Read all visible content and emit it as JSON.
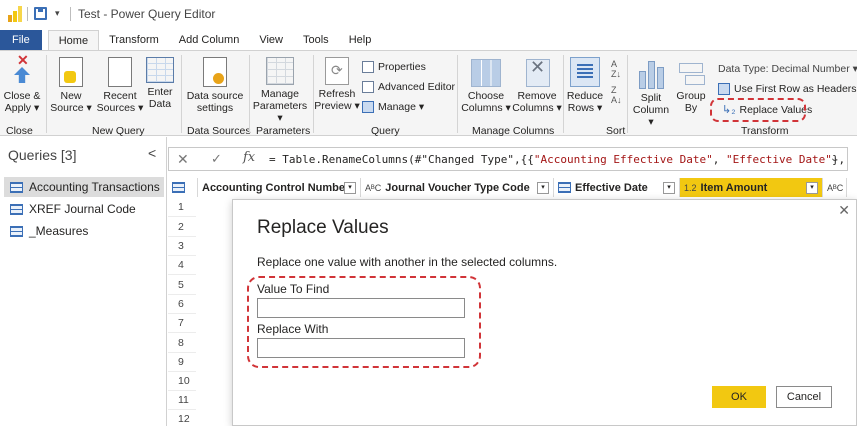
{
  "window": {
    "title": "Test - Power Query Editor",
    "qa_dropdown": "▾"
  },
  "tabs": [
    "File",
    "Home",
    "Transform",
    "Add Column",
    "View",
    "Tools",
    "Help"
  ],
  "ribbon": {
    "close_apply": [
      "Close &",
      "Apply ▾"
    ],
    "new_source": [
      "New",
      "Source ▾"
    ],
    "recent_sources": [
      "Recent",
      "Sources ▾"
    ],
    "enter_data": [
      "Enter",
      "Data"
    ],
    "data_source_settings": [
      "Data source",
      "settings"
    ],
    "manage_parameters": [
      "Manage",
      "Parameters ▾"
    ],
    "refresh_preview": [
      "Refresh",
      "Preview ▾"
    ],
    "properties": "Properties",
    "advanced_editor": "Advanced Editor",
    "manage": "Manage ▾",
    "choose_columns": [
      "Choose",
      "Columns ▾"
    ],
    "remove_columns": [
      "Remove",
      "Columns ▾"
    ],
    "reduce_rows": [
      "Reduce",
      "Rows ▾"
    ],
    "split_column": [
      "Split",
      "Column ▾"
    ],
    "group_by": [
      "Group",
      "By"
    ],
    "data_type": "Data Type: Decimal Number ▾",
    "use_first_row": "Use First Row as Headers ▾",
    "replace_values": "Replace Values",
    "groups": {
      "close": "Close",
      "new_query": "New Query",
      "data_sources": "Data Sources",
      "parameters": "Parameters",
      "query": "Query",
      "manage_columns": "Manage Columns",
      "sort": "Sort",
      "transform": "Transform"
    },
    "colors": {
      "file_tab": "#2b579a",
      "accent": "#f2c811",
      "highlight": "#d13438"
    }
  },
  "queries": {
    "header": "Queries [3]",
    "collapse_glyph": "<",
    "items": [
      "Accounting Transactions",
      "XREF Journal Code",
      "_Measures"
    ]
  },
  "formula": {
    "cancel_glyph": "✕",
    "ok_glyph": "✓",
    "fx": "fx",
    "prefix": "= Table.RenameColumns(#\"Changed Type\",{{",
    "str1": "\"Accounting Effective Date\"",
    "sep": ", ",
    "str2": "\"Effective Date\"",
    "suffix": "},",
    "expand_glyph": "⌄"
  },
  "grid": {
    "columns": [
      {
        "type": "",
        "name": "Accounting Control Number"
      },
      {
        "type": "AᴮC",
        "name": "Journal Voucher Type Code"
      },
      {
        "type": "",
        "name": "Effective Date"
      },
      {
        "type": "1.2",
        "name": "Item Amount"
      },
      {
        "type": "AᴮC",
        "name": ""
      }
    ],
    "row_numbers": [
      "1",
      "2",
      "3",
      "4",
      "5",
      "6",
      "7",
      "8",
      "9",
      "10",
      "11",
      "12"
    ]
  },
  "dialog": {
    "title": "Replace Values",
    "description": "Replace one value with another in the selected columns.",
    "value_to_find_label": "Value To Find",
    "value_to_find": "",
    "replace_with_label": "Replace With",
    "replace_with": "",
    "ok": "OK",
    "cancel": "Cancel",
    "close_glyph": "✕"
  }
}
